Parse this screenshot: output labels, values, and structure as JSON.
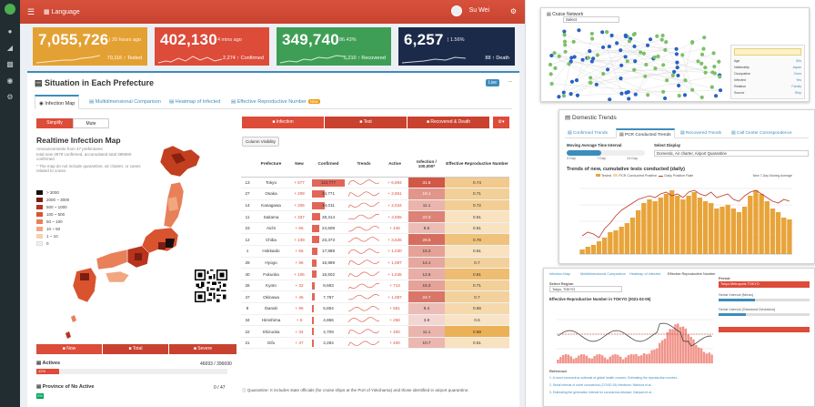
{
  "colors": {
    "accent_red": "#d8513c",
    "kpi_orange": "#e4a133",
    "kpi_red": "#dd4b39",
    "kpi_green": "#3f9e55",
    "kpi_navy": "#1c2a4a",
    "bar_orange": "#e8a43a",
    "line_red": "#c0392b",
    "node_green": "#7cc06a",
    "node_blue": "#2a62c4"
  },
  "topbar": {
    "lang_label": "Language",
    "user_label": "Su Wei"
  },
  "kpis": [
    {
      "value": "7,055,726",
      "sub": "| 20 hours ago",
      "foot": "70,116 ↑ Tested"
    },
    {
      "value": "402,130",
      "sub": "| 4 mins ago",
      "foot": "2,274 ↑ Confirmed"
    },
    {
      "value": "349,740",
      "sub": "| 86.43%",
      "foot": "5,210 ↑ Recovered"
    },
    {
      "value": "6,257",
      "sub": "| 1.56%",
      "foot": "88 ↑ Death"
    }
  ],
  "panel": {
    "title": "Situation in Each Prefecture",
    "live_badge": "Live",
    "collapse": "–",
    "tabs": [
      "Infection Map",
      "Multidimensional Comparison",
      "Heatmap of Infected",
      "Effective Reproductive Number"
    ],
    "new_badge": "New"
  },
  "map": {
    "toggle": [
      "Simplify",
      "Mute"
    ],
    "title": "Realtime Infection Map",
    "sub1": "Announcements from 47 prefectures",
    "sub2": "total new 3978 confirmed, accumulated total 396690 confirmed",
    "sub3": "* The map do not include quarantine, air charter, or cases related to cruise.",
    "legend": [
      "> 3000",
      "2000 ~ 3000",
      "500 ~ 1000",
      "100 ~ 500",
      "50 ~ 100",
      "10 ~ 50",
      "1 ~ 10",
      "0"
    ],
    "legend_colors": [
      "#1a0d0d",
      "#7a1d12",
      "#b8341d",
      "#d9532e",
      "#e8805a",
      "#f0a77f",
      "#f6cfb4",
      "#fbeee6"
    ]
  },
  "bottom_tabs": [
    "Now",
    "Total",
    "Severe"
  ],
  "actives": {
    "label": "Actives",
    "value": "46693 / 396690",
    "bar_text": "12%",
    "fraction": 0.12
  },
  "no_active": {
    "label": "Province of No Active",
    "value": "0 / 47",
    "chip": "0%"
  },
  "table_tabs": [
    "Infection",
    "Test",
    "Recovered & Death"
  ],
  "filter_button": "Column Visibility",
  "table": {
    "headers": [
      "",
      "Prefecture",
      "New",
      "Confirmed",
      "Trends",
      "Active",
      "Infection / 100,000*",
      "Effective Reproductive Number"
    ],
    "rows": [
      {
        "rank": "13",
        "pref": "Tokyo",
        "new": "+ 877",
        "conf": "110,777",
        "conf_frac": 1.0,
        "active": "+ 6,894",
        "inf": "31.6",
        "ern": "0.74"
      },
      {
        "rank": "27",
        "pref": "Osaka",
        "new": "+ 209",
        "conf": "44,771",
        "conf_frac": 0.4,
        "active": "+ 2,861",
        "inf": "18.1",
        "ern": "0.71"
      },
      {
        "rank": "14",
        "pref": "Kanagawa",
        "new": "+ 206",
        "conf": "44,011",
        "conf_frac": 0.4,
        "active": "+ 2,044",
        "inf": "11.1",
        "ern": "0.72"
      },
      {
        "rank": "11",
        "pref": "Saitama",
        "new": "+ 337",
        "conf": "28,314",
        "conf_frac": 0.26,
        "active": "+ 3,565",
        "inf": "22.0",
        "ern": "0.61"
      },
      {
        "rank": "23",
        "pref": "Aichi",
        "new": "+ 65",
        "conf": "24,508",
        "conf_frac": 0.22,
        "active": "+ 446",
        "inf": "9.6",
        "ern": "0.61"
      },
      {
        "rank": "12",
        "pref": "Chiba",
        "new": "+ 239",
        "conf": "23,373",
        "conf_frac": 0.21,
        "active": "+ 3,535",
        "inf": "26.5",
        "ern": "0.78"
      },
      {
        "rank": "1",
        "pref": "Hokkaido",
        "new": "+ 65",
        "conf": "17,888",
        "conf_frac": 0.16,
        "active": "+ 1,030",
        "inf": "15.3",
        "ern": "0.61"
      },
      {
        "rank": "28",
        "pref": "Hyogo",
        "new": "+ 96",
        "conf": "16,989",
        "conf_frac": 0.15,
        "active": "+ 1,087",
        "inf": "14.1",
        "ern": "0.7"
      },
      {
        "rank": "40",
        "pref": "Fukuoka",
        "new": "+ 106",
        "conf": "16,502",
        "conf_frac": 0.15,
        "active": "+ 1,045",
        "inf": "12.6",
        "ern": "0.81"
      },
      {
        "rank": "26",
        "pref": "Kyoto",
        "new": "+ 32",
        "conf": "8,683",
        "conf_frac": 0.08,
        "active": "+ 713",
        "inf": "15.3",
        "ern": "0.71"
      },
      {
        "rank": "47",
        "pref": "Okinawa",
        "new": "+ 45",
        "conf": "7,787",
        "conf_frac": 0.07,
        "active": "+ 1,087",
        "inf": "24.7",
        "ern": "0.7"
      },
      {
        "rank": "8",
        "pref": "Ibaraki",
        "new": "+ 96",
        "conf": "5,854",
        "conf_frac": 0.05,
        "active": "+ 581",
        "inf": "9.4",
        "ern": "0.66"
      },
      {
        "rank": "34",
        "pref": "Hiroshima",
        "new": "+ 5",
        "conf": "4,866",
        "conf_frac": 0.04,
        "active": "+ 268",
        "inf": "3.9",
        "ern": "0.6"
      },
      {
        "rank": "22",
        "pref": "Shizuoka",
        "new": "+ 34",
        "conf": "4,709",
        "conf_frac": 0.04,
        "active": "+ 400",
        "inf": "11.1",
        "ern": "0.88"
      },
      {
        "rank": "21",
        "pref": "Gifu",
        "new": "+ 37",
        "conf": "4,284",
        "conf_frac": 0.04,
        "active": "+ 400",
        "inf": "10.7",
        "ern": "0.61"
      }
    ]
  },
  "footnote": "Quarantine: It includes state officials (for cruise ships at the Port of Yokohama) and those identified in airport quarantine.",
  "cruise": {
    "title": "Cruise Network",
    "select_label": "Select",
    "right_items": [
      "Age",
      "Nationality",
      "Occupation",
      "Infected",
      "Relation",
      "Source"
    ],
    "right_values": [
      "60s",
      "Japan",
      "Crew",
      "Yes",
      "Family",
      "Ship"
    ]
  },
  "trends": {
    "title": "Domestic Trends",
    "tabs": [
      "Confirmed Trends",
      "PCR Conducted Trends",
      "Recovered Trends",
      "Call Center Correspondence"
    ],
    "ma_label": "Moving Average Time Interval",
    "ma_options": [
      "3 Day",
      "7 Day",
      "14 Day"
    ],
    "display_label": "Select Display",
    "display_value": "Domestic, Air charter, Airport Quarantine",
    "chart_title": "Trends of new, cumulative tests conducted (daily)",
    "legend": [
      "Tested",
      "PCR Conducted Positive",
      "Daily Positive Rate"
    ],
    "right_axis": "New 7-Day Moving Average"
  },
  "ern": {
    "tabs": [
      "Infection Map",
      "Multidimensional Comparison",
      "Heatmap of Infected",
      "Effective Reproductive Number"
    ],
    "select_label": "Select Region",
    "select_value": "Tokyo, TOKYO",
    "chart_title": "Effective Reproductive Number in TOKYO (2021-02-05)",
    "panel_label": "Period",
    "panel_value": "Tokyo Metropolis TOKYO",
    "slider_labels": [
      "Serial Interval (Mean)",
      "Serial Interval (Standard Deviation)"
    ],
    "bottom_label": "Reference",
    "refs": [
      "1. A novel coronavirus outbreak of global health concern; Estimating the reproduction number...",
      "2. Serial interval of novel coronavirus (COVID-19) infections; Nishiura et al...",
      "3. Estimating the generation interval for coronavirus disease; Ganyani et al..."
    ]
  }
}
